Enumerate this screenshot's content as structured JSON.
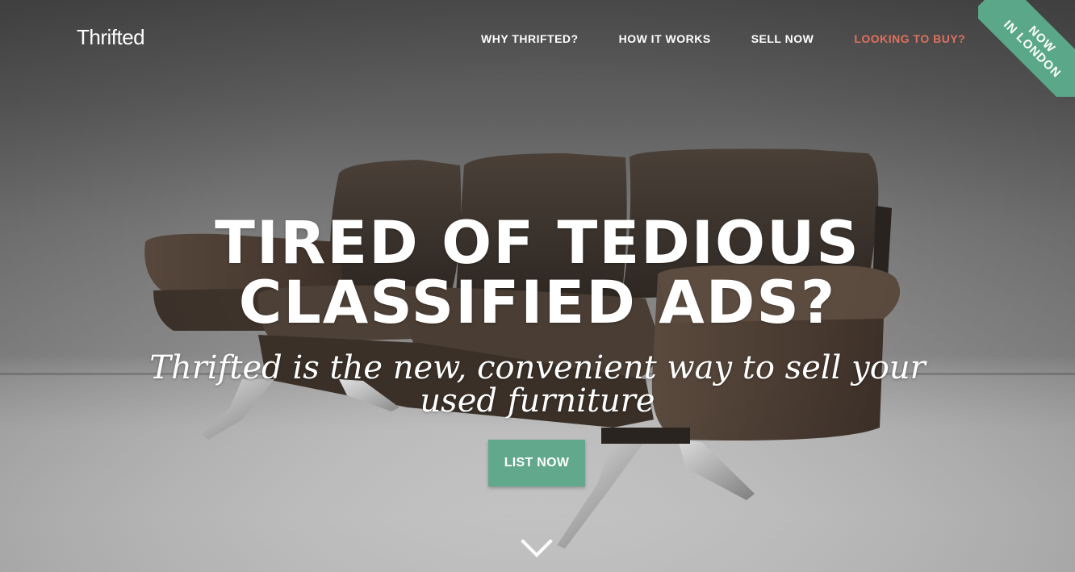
{
  "brand": {
    "name": "Thrifted"
  },
  "nav": {
    "items": [
      {
        "label": "WHY THRIFTED?"
      },
      {
        "label": "HOW IT WORKS"
      },
      {
        "label": "SELL NOW"
      },
      {
        "label": "LOOKING TO BUY?"
      }
    ]
  },
  "ribbon": {
    "line1": "NOW",
    "line2": "IN LONDON"
  },
  "hero": {
    "title_line1": "TIRED OF TEDIOUS",
    "title_line2": "CLASSIFIED ADS?",
    "subtitle": "Thrifted is the new, convenient way to sell your used furniture",
    "cta_label": "LIST NOW",
    "scroll_icon": "chevron-down-icon"
  },
  "colors": {
    "accent_nav": "#e0705e",
    "cta_green": "#62a88d",
    "ribbon_green": "#5aa889",
    "text": "#ffffff"
  }
}
